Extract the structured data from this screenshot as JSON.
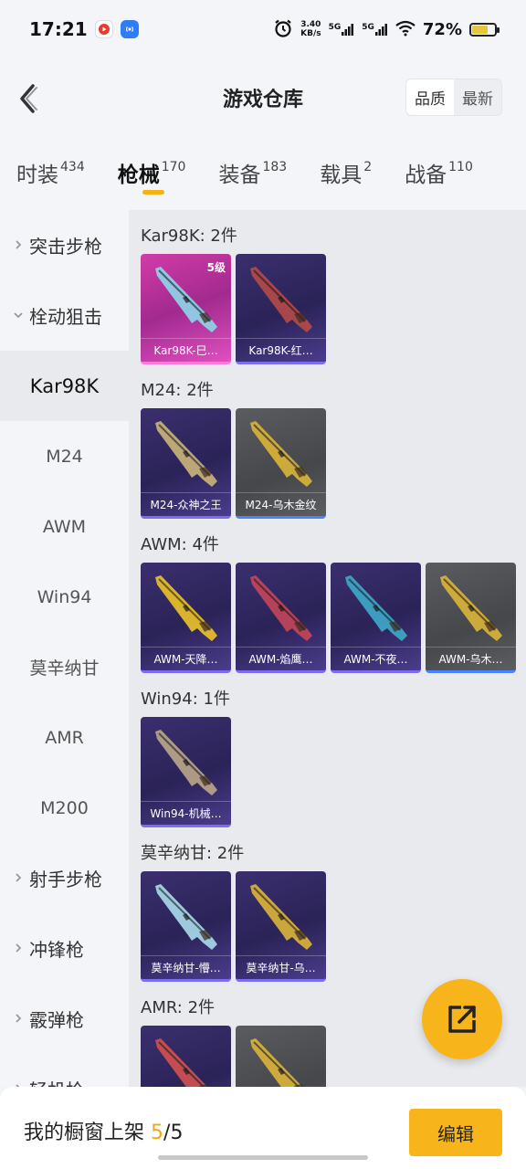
{
  "status_bar": {
    "time": "17:21",
    "net_speed_value": "3.40",
    "net_speed_unit": "KB/s",
    "signal_label_1": "5G",
    "signal_label_2": "5G",
    "battery": "72%",
    "battery_level": 0.72
  },
  "header": {
    "title": "游戏仓库",
    "sort_options": [
      "品质",
      "最新"
    ],
    "sort_selected": "品质"
  },
  "tabs": [
    {
      "name": "时装",
      "count": "434"
    },
    {
      "name": "枪械",
      "count": "170",
      "active": true
    },
    {
      "name": "装备",
      "count": "183"
    },
    {
      "name": "载具",
      "count": "2"
    },
    {
      "name": "战备",
      "count": "110"
    }
  ],
  "sidebar": [
    {
      "label": "突击步枪",
      "type": "category",
      "chevron": ">"
    },
    {
      "label": "栓动狙击",
      "type": "category",
      "chevron": "v"
    },
    {
      "label": "Kar98K",
      "type": "sub",
      "selected": true
    },
    {
      "label": "M24",
      "type": "sub"
    },
    {
      "label": "AWM",
      "type": "sub"
    },
    {
      "label": "Win94",
      "type": "sub"
    },
    {
      "label": "莫辛纳甘",
      "type": "sub"
    },
    {
      "label": "AMR",
      "type": "sub"
    },
    {
      "label": "M200",
      "type": "sub"
    },
    {
      "label": "射手步枪",
      "type": "category",
      "chevron": ">"
    },
    {
      "label": "冲锋枪",
      "type": "category",
      "chevron": ">"
    },
    {
      "label": "霰弹枪",
      "type": "category",
      "chevron": ">"
    },
    {
      "label": "轻机枪",
      "type": "category",
      "chevron": ">"
    }
  ],
  "groups": [
    {
      "title": "Kar98K: 2件",
      "items": [
        {
          "label": "Kar98K-巳…",
          "style": "pink",
          "level": "5级",
          "gun_color": "#8fd3e6"
        },
        {
          "label": "Kar98K-红…",
          "style": "purple",
          "gun_color": "#b24a4a"
        }
      ]
    },
    {
      "title": "M24: 2件",
      "items": [
        {
          "label": "M24-众神之王",
          "style": "purple",
          "gun_color": "#c9b27a"
        },
        {
          "label": "M24-乌木金纹",
          "style": "gray",
          "gun_color": "#d8b23a"
        }
      ]
    },
    {
      "title": "AWM: 4件",
      "items": [
        {
          "label": "AWM-天降…",
          "style": "purple",
          "gun_color": "#e8c02a"
        },
        {
          "label": "AWM-焰鹰…",
          "style": "purple",
          "gun_color": "#c0455a"
        },
        {
          "label": "AWM-不夜…",
          "style": "purple",
          "gun_color": "#3fa6c8"
        },
        {
          "label": "AWM-乌木…",
          "style": "gray",
          "gun_color": "#d8b23a"
        }
      ]
    },
    {
      "title": "Win94: 1件",
      "items": [
        {
          "label": "Win94-机械…",
          "style": "purple",
          "gun_color": "#b8a58a"
        }
      ]
    },
    {
      "title": "莫辛纳甘: 2件",
      "items": [
        {
          "label": "莫辛纳甘-懵…",
          "style": "purple",
          "gun_color": "#a8d8e8"
        },
        {
          "label": "莫辛纳甘-乌…",
          "style": "purple",
          "gun_color": "#d8b23a"
        }
      ]
    },
    {
      "title": "AMR: 2件",
      "items": [
        {
          "label": "",
          "style": "purple",
          "gun_color": "#d05050"
        },
        {
          "label": "",
          "style": "gray",
          "gun_color": "#d8b23a"
        }
      ]
    }
  ],
  "bottom_bar": {
    "shelf_label": "我的橱窗上架",
    "current": "5",
    "separator": "/",
    "total": "5",
    "edit_label": "编辑"
  },
  "colors": {
    "accent": "#f7b51b",
    "purple_card": "#2a2357",
    "pink_card": "#d13ca8",
    "gray_card": "#5a5c60"
  }
}
